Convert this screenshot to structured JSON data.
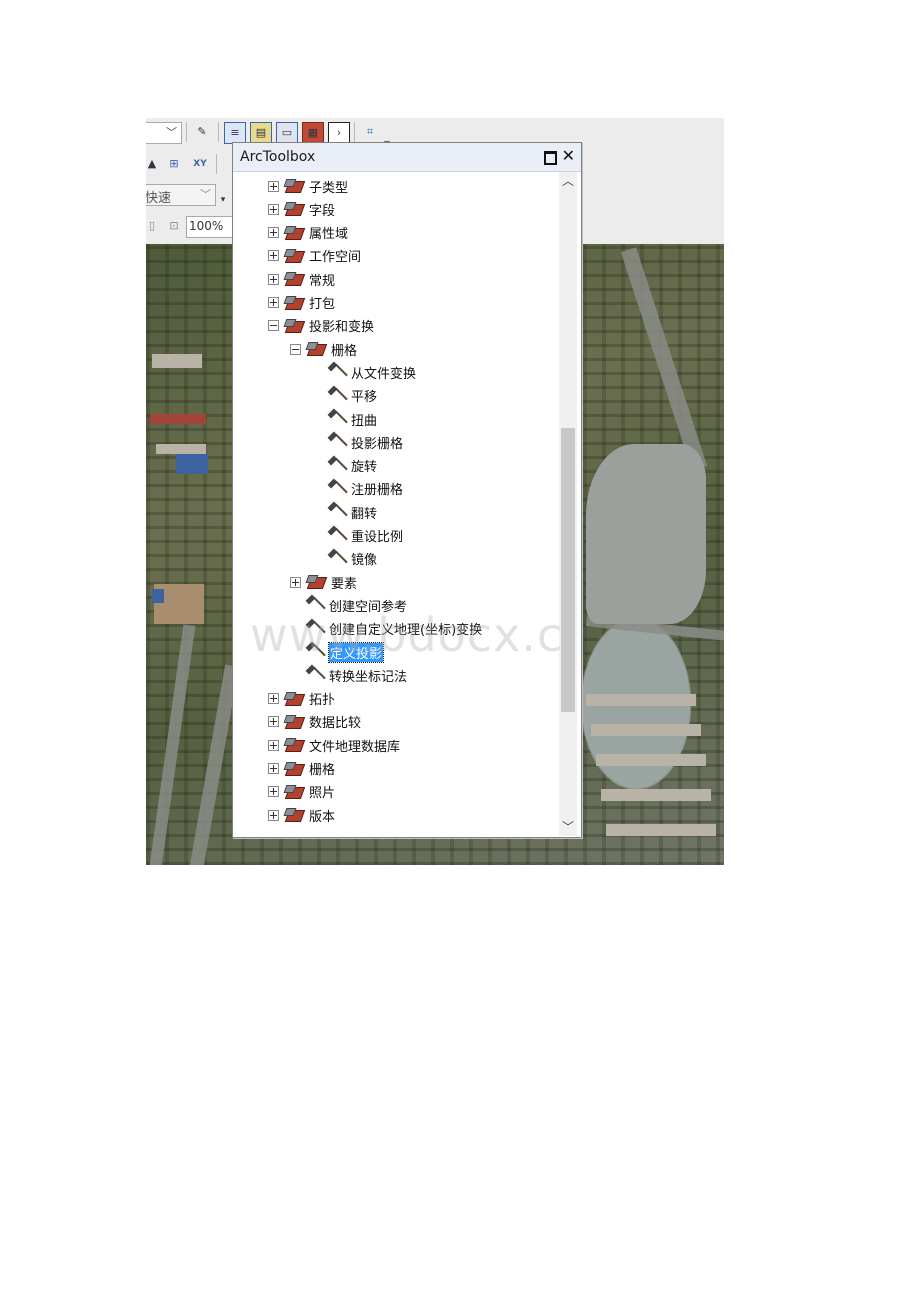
{
  "toolbar": {
    "speed_combo": "快速",
    "zoom_value": "100%"
  },
  "arctoolbox": {
    "title": "ArcToolbox",
    "items": [
      {
        "label": "子类型",
        "kind": "toolbox",
        "expander": "plus"
      },
      {
        "label": "字段",
        "kind": "toolbox",
        "expander": "plus"
      },
      {
        "label": "属性域",
        "kind": "toolbox",
        "expander": "plus"
      },
      {
        "label": "工作空间",
        "kind": "toolbox",
        "expander": "plus"
      },
      {
        "label": "常规",
        "kind": "toolbox",
        "expander": "plus"
      },
      {
        "label": "打包",
        "kind": "toolbox",
        "expander": "plus"
      },
      {
        "label": "投影和变换",
        "kind": "toolbox",
        "expander": "minus"
      },
      {
        "label": "栅格",
        "kind": "toolbox",
        "expander": "minus"
      },
      {
        "label": "从文件变换",
        "kind": "tool"
      },
      {
        "label": "平移",
        "kind": "tool"
      },
      {
        "label": "扭曲",
        "kind": "tool"
      },
      {
        "label": "投影栅格",
        "kind": "tool"
      },
      {
        "label": "旋转",
        "kind": "tool"
      },
      {
        "label": "注册栅格",
        "kind": "tool"
      },
      {
        "label": "翻转",
        "kind": "tool"
      },
      {
        "label": "重设比例",
        "kind": "tool"
      },
      {
        "label": "镜像",
        "kind": "tool"
      },
      {
        "label": "要素",
        "kind": "toolbox",
        "expander": "plus"
      },
      {
        "label": "创建空间参考",
        "kind": "tool"
      },
      {
        "label": "创建自定义地理(坐标)变换",
        "kind": "tool"
      },
      {
        "label": "定义投影",
        "kind": "tool",
        "selected": true
      },
      {
        "label": "转换坐标记法",
        "kind": "tool"
      },
      {
        "label": "拓扑",
        "kind": "toolbox",
        "expander": "plus"
      },
      {
        "label": "数据比较",
        "kind": "toolbox",
        "expander": "plus"
      },
      {
        "label": "文件地理数据库",
        "kind": "toolbox",
        "expander": "plus"
      },
      {
        "label": "栅格",
        "kind": "toolbox",
        "expander": "plus"
      },
      {
        "label": "照片",
        "kind": "toolbox",
        "expander": "plus"
      },
      {
        "label": "版本",
        "kind": "toolbox",
        "expander": "plus"
      }
    ]
  },
  "watermark": "www.bdocx.c"
}
